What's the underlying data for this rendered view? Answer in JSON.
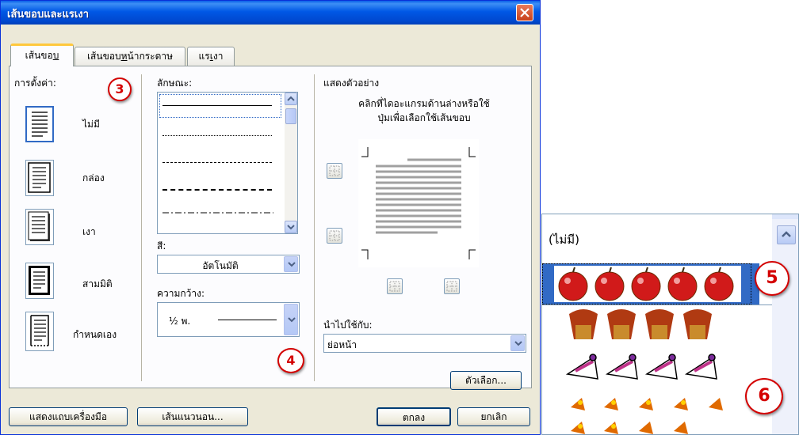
{
  "dialog": {
    "title": "เส้นขอบและแรเงา",
    "tabs": [
      {
        "label_pre": "เส้นขอ",
        "label_u": "บ",
        "label_post": ""
      },
      {
        "label_pre": "เส้นขอบ",
        "label_u": "ห",
        "label_post": "น้ากระดาษ"
      },
      {
        "label_pre": "แร",
        "label_u": "เ",
        "label_post": "งา"
      }
    ],
    "settings": {
      "label": "การตั้งค่า:",
      "presets": [
        {
          "label": "ไม่มี"
        },
        {
          "label": "กล่อง"
        },
        {
          "label": "เงา"
        },
        {
          "label": "สามมิติ"
        },
        {
          "label": "กำหนดเอง"
        }
      ]
    },
    "style": {
      "label": "ลักษณะ:"
    },
    "color": {
      "label": "สี:",
      "value": "อัตโนมัติ"
    },
    "width": {
      "label": "ความกว้าง:",
      "value": "½ พ."
    },
    "preview": {
      "label": "แสดงตัวอย่าง",
      "hint_line1": "คลิกที่ไดอะแกรมด้านล่างหรือใช้",
      "hint_line2": "ปุ่มเพื่อเลือกใช้เส้นขอบ"
    },
    "apply": {
      "label": "นำไปใช้กับ:",
      "value": "ย่อหน้า"
    },
    "options_button": "ตัวเลือก...",
    "toolbar_button": "แสดงแถบเครื่องมือ",
    "horizontal_line_button": "เส้นแนวนอน...",
    "ok_button": "ตกลง",
    "cancel_button": "ยกเลิก"
  },
  "art_list": {
    "none_label": "(ไม่มี)"
  },
  "markers": [
    "3",
    "4",
    "5",
    "6"
  ],
  "colors": {
    "accent": "#316ac5",
    "marker": "#d40000",
    "titlebar": "#0058e6",
    "face": "#ece9d8"
  }
}
